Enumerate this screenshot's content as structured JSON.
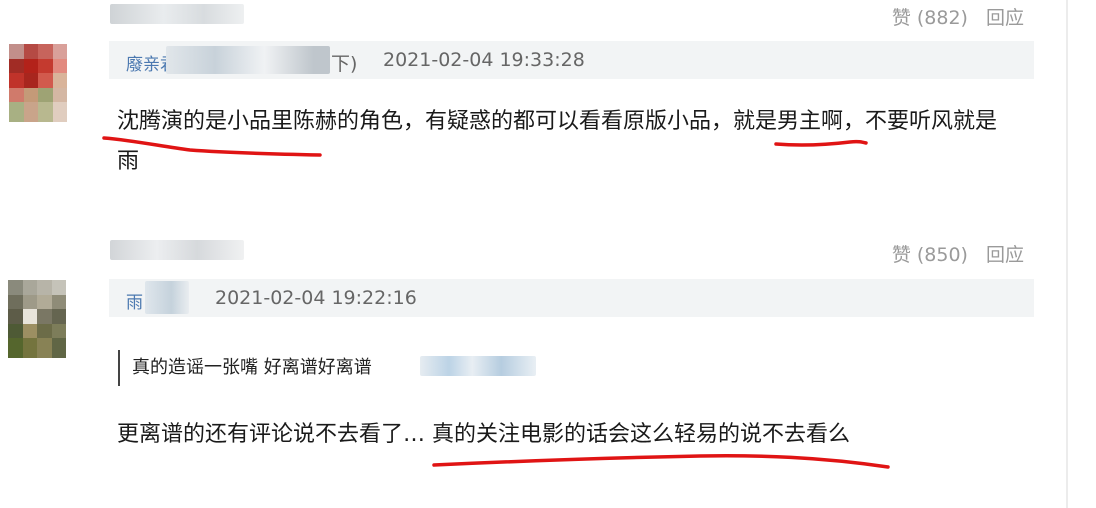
{
  "colors": {
    "annotation_red": "#e01414",
    "link_blue": "#4b78b0",
    "meta_gray": "#9a9a9a"
  },
  "comments": [
    {
      "like_label": "赞 (882)",
      "reply_label": "回应",
      "quoted": {
        "name_visible": "廢亲君",
        "suffix": "下)",
        "timestamp": "2021-02-04 19:33:28"
      },
      "text_line1": "沈腾演的是小品里陈赫的角色，有疑惑的都可以看看原版小品，就是男主啊，不要听风就是",
      "text_line2": "雨"
    },
    {
      "like_label": "赞 (850)",
      "reply_label": "回应",
      "quoted": {
        "name_visible": "雨",
        "timestamp": "2021-02-04 19:22:16"
      },
      "reply_quote": "真的造谣一张嘴 好离谱好离谱",
      "text": "更离谱的还有评论说不去看了… 真的关注电影的话会这么轻易的说不去看么"
    }
  ]
}
